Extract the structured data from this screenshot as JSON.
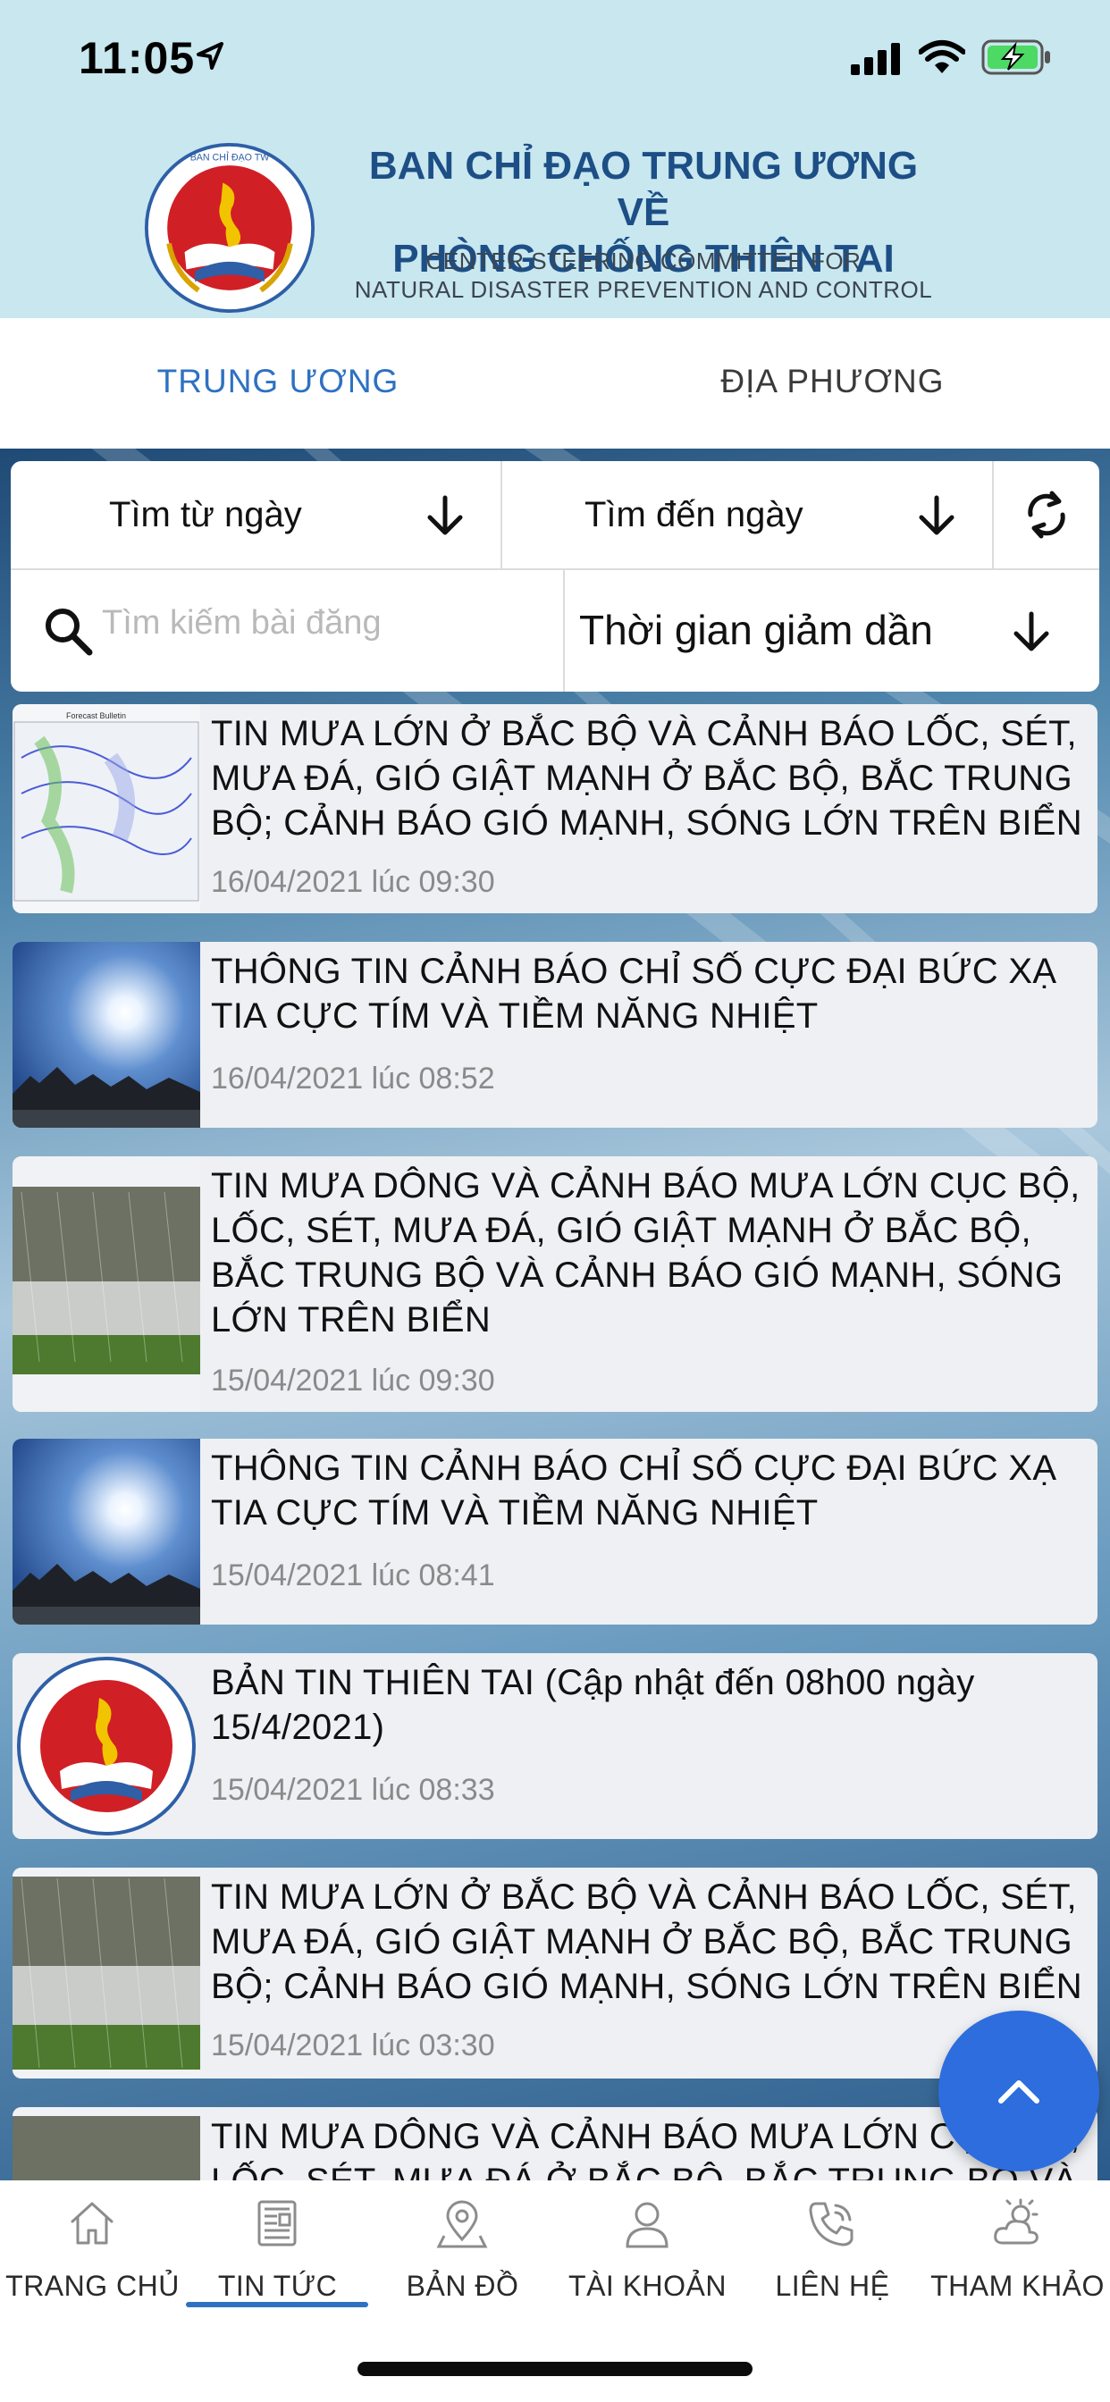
{
  "status_bar": {
    "time": "11:05"
  },
  "org": {
    "title_line1": "BAN CHỈ ĐẠO TRUNG ƯƠNG VỀ",
    "title_line2": "PHÒNG CHỐNG THIÊN TAI",
    "subtitle_line1": "CENTER STEERING COMMITTEE FOR",
    "subtitle_line2": "NATURAL DISASTER PREVENTION AND CONTROL"
  },
  "tabs": {
    "central": "TRUNG ƯƠNG",
    "local": "ĐỊA PHƯƠNG"
  },
  "filters": {
    "from_date": "Tìm từ ngày",
    "to_date": "Tìm đến ngày",
    "search_placeholder": "Tìm kiếm bài đăng",
    "search_value": "",
    "sort": "Thời gian giảm dần"
  },
  "news": [
    {
      "title": "TIN MƯA LỚN Ở BẮC BỘ VÀ CẢNH BÁO LỐC, SÉT, MƯA ĐÁ, GIÓ GIẬT MẠNH Ở BẮC BỘ, BẮC TRUNG BỘ; CẢNH BÁO GIÓ MẠNH, SÓNG LỚN TRÊN BIỂN",
      "date": "16/04/2021 lúc 09:30",
      "thumb": "weather-map"
    },
    {
      "title": "THÔNG TIN CẢNH BÁO CHỈ SỐ CỰC ĐẠI BỨC XẠ TIA CỰC TÍM VÀ TIỀM NĂNG NHIỆT",
      "date": "16/04/2021 lúc 08:52",
      "thumb": "sun"
    },
    {
      "title": "TIN MƯA DÔNG VÀ CẢNH BÁO MƯA LỚN CỤC BỘ, LỐC, SÉT, MƯA ĐÁ, GIÓ GIẬT MẠNH Ở BẮC BỘ, BẮC TRUNG BỘ VÀ CẢNH BÁO GIÓ MẠNH, SÓNG LỚN TRÊN BIỂN",
      "date": "15/04/2021 lúc 09:30",
      "thumb": "hail"
    },
    {
      "title": "THÔNG TIN CẢNH BÁO CHỈ SỐ CỰC ĐẠI BỨC XẠ TIA CỰC TÍM VÀ TIỀM NĂNG NHIỆT",
      "date": "15/04/2021 lúc 08:41",
      "thumb": "sun"
    },
    {
      "title": "BẢN TIN THIÊN TAI (Cập nhật đến 08h00 ngày 15/4/2021)",
      "date": "15/04/2021 lúc 08:33",
      "thumb": "logo"
    },
    {
      "title": "TIN MƯA LỚN Ở BẮC BỘ VÀ CẢNH BÁO LỐC, SÉT, MƯA ĐÁ, GIÓ GIẬT MẠNH Ở BẮC BỘ, BẮC TRUNG BỘ; CẢNH BÁO GIÓ MẠNH, SÓNG LỚN TRÊN BIỂN",
      "date": "15/04/2021 lúc 03:30",
      "thumb": "hail"
    },
    {
      "title": "TIN MƯA DÔNG VÀ CẢNH BÁO MƯA LỚN CỤC BỘ, LỐC, SÉT, MƯA ĐÁ Ở BẮC BỘ, BẮC TRUNG BỘ VÀ",
      "date": "",
      "thumb": "hail"
    }
  ],
  "bottom_nav": [
    {
      "label": "TRANG CHỦ",
      "icon": "home-icon"
    },
    {
      "label": "TIN TỨC",
      "icon": "news-icon",
      "active": true
    },
    {
      "label": "BẢN ĐỒ",
      "icon": "map-pin-icon"
    },
    {
      "label": "TÀI KHOẢN",
      "icon": "user-icon"
    },
    {
      "label": "LIÊN HỆ",
      "icon": "phone-icon"
    },
    {
      "label": "THAM KHẢO",
      "icon": "weather-icon"
    }
  ],
  "colors": {
    "accent": "#2e71c2",
    "header_bg": "#c8e7ef",
    "fab": "#2d6dde"
  }
}
